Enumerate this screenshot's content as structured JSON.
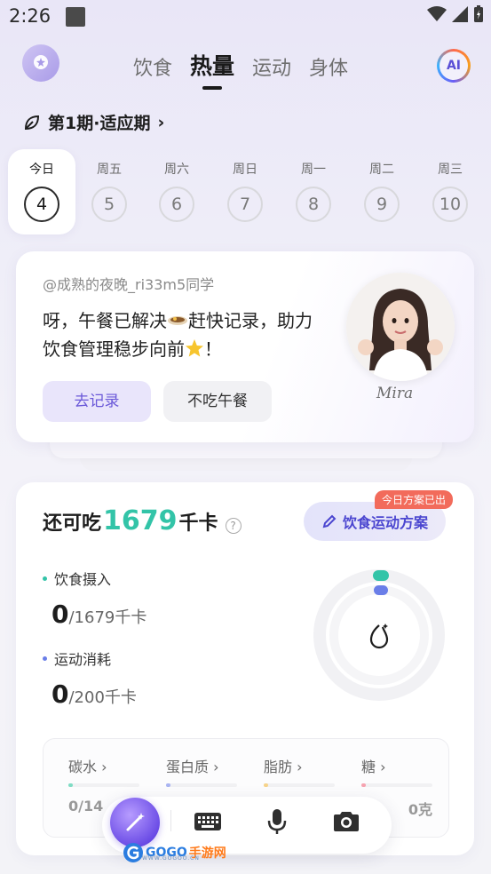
{
  "status": {
    "time": "2:26"
  },
  "header": {
    "tabs": [
      {
        "label": "饮食",
        "active": false
      },
      {
        "label": "热量",
        "active": true
      },
      {
        "label": "运动",
        "active": false
      },
      {
        "label": "身体",
        "active": false
      }
    ],
    "ai_label": "AI"
  },
  "period": {
    "label": "第1期·适应期",
    "chevron": "›"
  },
  "days": [
    {
      "label": "今日",
      "date": "4",
      "active": true
    },
    {
      "label": "周五",
      "date": "5"
    },
    {
      "label": "周六",
      "date": "6"
    },
    {
      "label": "周日",
      "date": "7"
    },
    {
      "label": "周一",
      "date": "8"
    },
    {
      "label": "周二",
      "date": "9"
    },
    {
      "label": "周三",
      "date": "10"
    }
  ],
  "greeting": {
    "user": "@成熟的夜晚_ri33m5同学",
    "message_part1": "呀，午餐已解决",
    "message_part2": "赶快记录，助力饮食管理稳步向前",
    "message_end": "！",
    "record_button": "去记录",
    "skip_button": "不吃午餐",
    "signature": "Mira"
  },
  "calories": {
    "remain_prefix": "还可吃",
    "remain_value": "1679",
    "remain_unit": "千卡",
    "help": "?",
    "plan_button": "饮食运动方案",
    "plan_badge": "今日方案已出",
    "intake": {
      "label": "饮食摄入",
      "value": "0",
      "total": "/1679千卡",
      "color": "#33c4a8"
    },
    "burn": {
      "label": "运动消耗",
      "value": "0",
      "total": "/200千卡",
      "color": "#6a7ee8"
    },
    "macros": [
      {
        "name": "碳水",
        "chevron": "›",
        "value": "0/14",
        "color": "#7fdcc4"
      },
      {
        "name": "蛋白质",
        "chevron": "›",
        "value": "",
        "color": "#a9b4f2"
      },
      {
        "name": "脂肪",
        "chevron": "›",
        "value": "",
        "color": "#f6d38a"
      },
      {
        "name": "糖",
        "chevron": "›",
        "value": "0克",
        "color": "#f6a3b0"
      }
    ]
  },
  "bottom_bar": {
    "items": [
      "magic-wand-icon",
      "keyboard-icon",
      "microphone-icon",
      "camera-icon"
    ]
  },
  "watermark": {
    "text": "GOGO",
    "cn": "手游网",
    "sub": "WWW.GOGOO.CN"
  }
}
